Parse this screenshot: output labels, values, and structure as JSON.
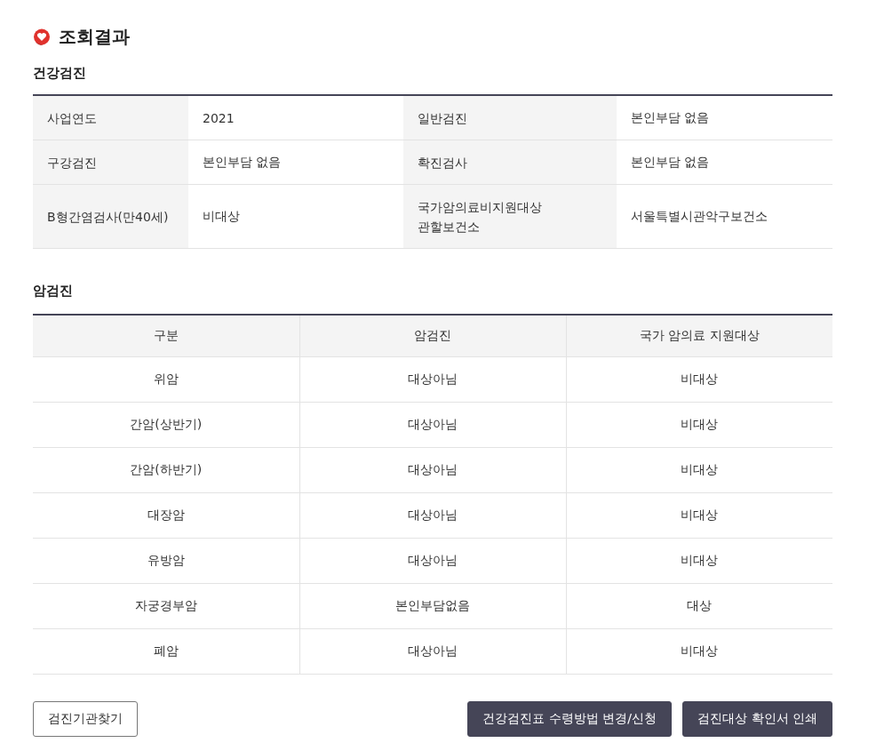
{
  "page_title": "조회결과",
  "health_checkup": {
    "title": "건강검진",
    "rows": [
      [
        {
          "label": "사업연도",
          "value": "2021"
        },
        {
          "label": "일반검진",
          "value": "본인부담 없음"
        }
      ],
      [
        {
          "label": "구강검진",
          "value": "본인부담 없음"
        },
        {
          "label": "확진검사",
          "value": "본인부담 없음"
        }
      ],
      [
        {
          "label": "B형간염검사(만40세)",
          "value": "비대상"
        },
        {
          "label": "국가암의료비지원대상\n관할보건소",
          "value": "서울특별시관악구보건소"
        }
      ]
    ]
  },
  "cancer_checkup": {
    "title": "암검진",
    "columns": [
      "구분",
      "암검진",
      "국가 암의료 지원대상"
    ],
    "rows": [
      [
        "위암",
        "대상아님",
        "비대상"
      ],
      [
        "간암(상반기)",
        "대상아님",
        "비대상"
      ],
      [
        "간암(하반기)",
        "대상아님",
        "비대상"
      ],
      [
        "대장암",
        "대상아님",
        "비대상"
      ],
      [
        "유방암",
        "대상아님",
        "비대상"
      ],
      [
        "자궁경부암",
        "본인부담없음",
        "대상"
      ],
      [
        "폐암",
        "대상아님",
        "비대상"
      ]
    ]
  },
  "buttons": [
    {
      "label": "검진기관찾기",
      "kind": "outline"
    },
    {
      "label": "건강검진표 수령방법 변경/신청",
      "kind": "filled"
    },
    {
      "label": "검진대상 확인서 인쇄",
      "kind": "filled"
    }
  ]
}
